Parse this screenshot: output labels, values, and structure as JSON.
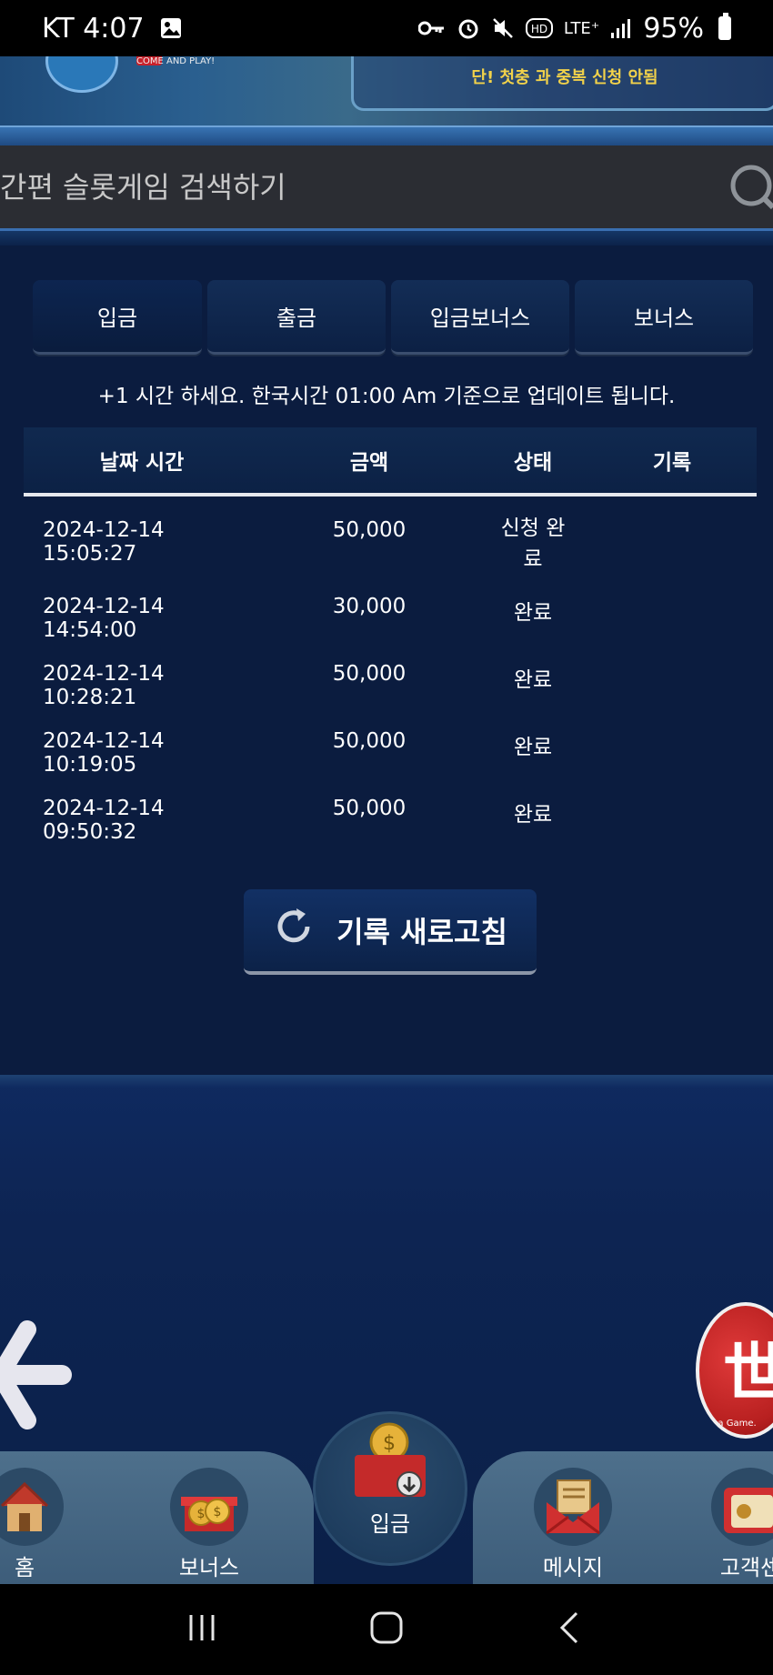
{
  "status_bar": {
    "carrier_time": "KT 4:07",
    "network": "LTE⁺",
    "battery": "95%"
  },
  "banner": {
    "logo_caption": "COME AND PLAY!",
    "notice_line2": "단! 첫충 과 중복 신청 안됨"
  },
  "search": {
    "placeholder": "간편 슬롯게임 검색하기"
  },
  "tabs": [
    "입금",
    "출금",
    "입금보너스",
    "보너스"
  ],
  "notice": "+1 시간 하세요. 한국시간 01:00 Am 기준으로 업데이트 됩니다.",
  "table": {
    "headers": {
      "date": "날짜 시간",
      "amount": "금액",
      "status": "상태",
      "record": "기록"
    },
    "rows": [
      {
        "date": "2024-12-14 15:05:27",
        "amount": "50,000",
        "status": "신청 완료"
      },
      {
        "date": "2024-12-14 14:54:00",
        "amount": "30,000",
        "status": "완료"
      },
      {
        "date": "2024-12-14 10:28:21",
        "amount": "50,000",
        "status": "완료"
      },
      {
        "date": "2024-12-14 10:19:05",
        "amount": "50,000",
        "status": "완료"
      },
      {
        "date": "2024-12-14 09:50:32",
        "amount": "50,000",
        "status": "완료"
      }
    ]
  },
  "refresh_button": "기록 새로고침",
  "game_badge": {
    "glyph": "世",
    "caption": "s a Game."
  },
  "bottom_nav": {
    "home": "홈",
    "bonus": "보너스",
    "deposit": "입금",
    "message": "메시지",
    "support": "고객센"
  },
  "colors": {
    "background": "#0b1c3f",
    "accent_blue": "#3a6fb0",
    "nav_bar": "#4e708c",
    "badge_red": "#c8202a"
  }
}
